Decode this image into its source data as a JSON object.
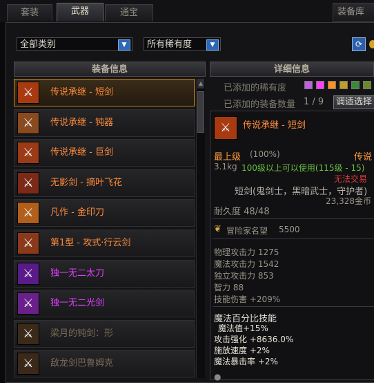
{
  "tabs": {
    "armor": "套装",
    "weapon": "武器",
    "treasure": "通宝",
    "storage": "装备库"
  },
  "filters": {
    "category": "全部类别",
    "rarity": "所有稀有度"
  },
  "columns": {
    "list": "装备信息",
    "detail": "详细信息"
  },
  "items": [
    {
      "name": "传说承继 - 短剑",
      "color": "#ff8a3a",
      "icon_color": "#a83a12",
      "icon": "sword-icon"
    },
    {
      "name": "传说承继 - 钝器",
      "color": "#ff8a3a",
      "icon_color": "#8a4a20",
      "icon": "mace-icon"
    },
    {
      "name": "传说承继 - 巨剑",
      "color": "#ff8a3a",
      "icon_color": "#9a3a16",
      "icon": "greatsword-icon"
    },
    {
      "name": "无影剑 - 摘叶飞花",
      "color": "#ff8a3a",
      "icon_color": "#7a2a16",
      "icon": "sword-icon"
    },
    {
      "name": "凡作 - 金印刀",
      "color": "#ff8a3a",
      "icon_color": "#b0601a",
      "icon": "blade-icon"
    },
    {
      "name": "第1型 - 攻式·行云剑",
      "color": "#ff8a3a",
      "icon_color": "#8a3a1a",
      "icon": "sword-icon"
    },
    {
      "name": "独一无二太刀",
      "color": "#e040ff",
      "icon_color": "#5a1a8a",
      "icon": "katana-icon"
    },
    {
      "name": "独一无二光剑",
      "color": "#e040ff",
      "icon_color": "#6a208a",
      "icon": "lightsaber-icon"
    },
    {
      "name": "梁月的钝剑：形",
      "color": "#7a6a55",
      "icon_color": "#3a2a1a",
      "icon": "bluntsword-icon"
    },
    {
      "name": "敌龙剑巴鲁姆克",
      "color": "#7a6a55",
      "icon_color": "#3a2818",
      "icon": "sword-icon"
    }
  ],
  "detail": {
    "rarity_label": "已添加的稀有度",
    "count_label": "已添加的装备数量",
    "count_value": "1 / 9",
    "select_button": "调适选择",
    "rarity_colors": [
      "#c060e0",
      "#ff40ff",
      "#ff9020",
      "#c0a020",
      "#3a8a3a",
      "#6a8a2a"
    ],
    "item_name": "传说承继 - 短剑",
    "level_label": "最上级",
    "level_pct": "(100%)",
    "grade_tag": "传说",
    "weight": "3.1kg",
    "usable": "100级以上可以使用(115级 - 15)",
    "untradeable": "无法交易",
    "classes": "短剑(鬼剑士，黑暗武士，守护者)",
    "price": "23,328金币",
    "durability": "耐久度 48/48",
    "fame_label": "冒险家名望",
    "fame_value": "5500",
    "stats": [
      "物理攻击力 1275",
      "魔法攻击力 1542",
      "独立攻击力 853",
      "智力 88",
      "技能伤害 +209%"
    ],
    "skill_title": "魔法百分比技能",
    "skill_stats": [
      "魔法值+15%",
      "攻击强化 +8636.0%",
      "施放速度 +2%",
      "魔法暴击率 +2%"
    ]
  }
}
